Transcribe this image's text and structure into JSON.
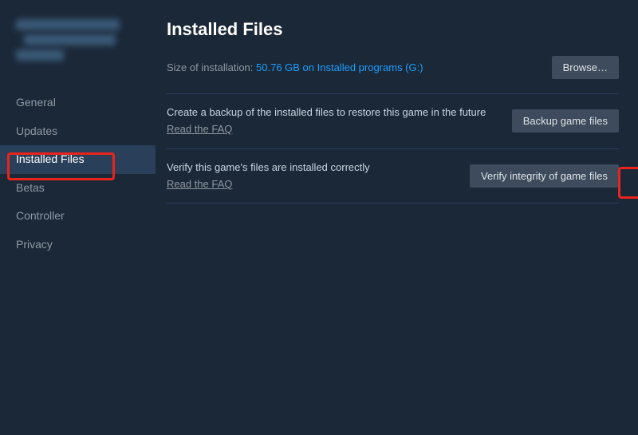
{
  "window_controls": {
    "minimize": "–",
    "maximize": "☐",
    "close": "✕"
  },
  "sidebar": {
    "items": [
      {
        "label": "General"
      },
      {
        "label": "Updates"
      },
      {
        "label": "Installed Files"
      },
      {
        "label": "Betas"
      },
      {
        "label": "Controller"
      },
      {
        "label": "Privacy"
      }
    ]
  },
  "main": {
    "title": "Installed Files",
    "size_label": "Size of installation: ",
    "size_value": "50.76 GB on Installed programs (G:)",
    "browse_label": "Browse…",
    "backup": {
      "desc": "Create a backup of the installed files to restore this game in the future",
      "faq": "Read the FAQ",
      "button": "Backup game files"
    },
    "verify": {
      "desc": "Verify this game's files are installed correctly",
      "faq": "Read the FAQ",
      "button": "Verify integrity of game files"
    }
  }
}
